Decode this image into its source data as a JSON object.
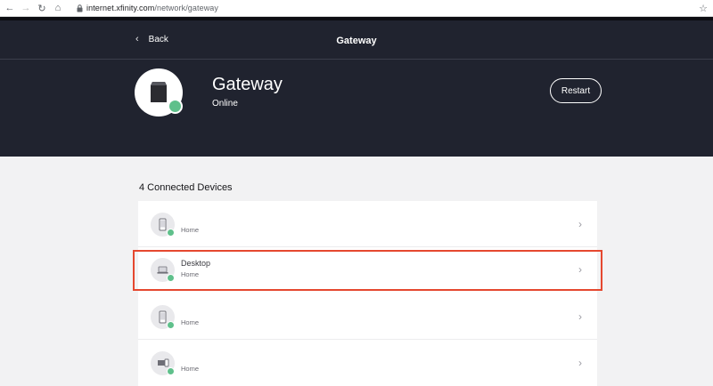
{
  "browser": {
    "url_host": "internet.xfinity.com",
    "url_path": "/network/gateway",
    "icons": {
      "back": "arrow-left-icon",
      "forward": "arrow-right-icon",
      "reload": "reload-icon",
      "home": "home-icon",
      "lock": "lock-icon",
      "star": "star-icon"
    }
  },
  "header": {
    "back_label": "Back",
    "title": "Gateway"
  },
  "gateway": {
    "name": "Gateway",
    "status": "Online",
    "restart_label": "Restart",
    "status_color": "#5fc08b"
  },
  "devices": {
    "title": "4 Connected Devices",
    "items": [
      {
        "name": "",
        "group": "Home",
        "icon": "phone-icon",
        "online": true
      },
      {
        "name": "Desktop",
        "group": "Home",
        "icon": "laptop-icon",
        "online": true
      },
      {
        "name": "",
        "group": "Home",
        "icon": "phone-icon",
        "online": true
      },
      {
        "name": "",
        "group": "Home",
        "icon": "devices-icon",
        "online": true
      }
    ]
  },
  "colors": {
    "header_bg": "#20232f",
    "page_bg": "#f2f2f3",
    "online": "#5fc08b",
    "highlight": "#e5482f"
  }
}
